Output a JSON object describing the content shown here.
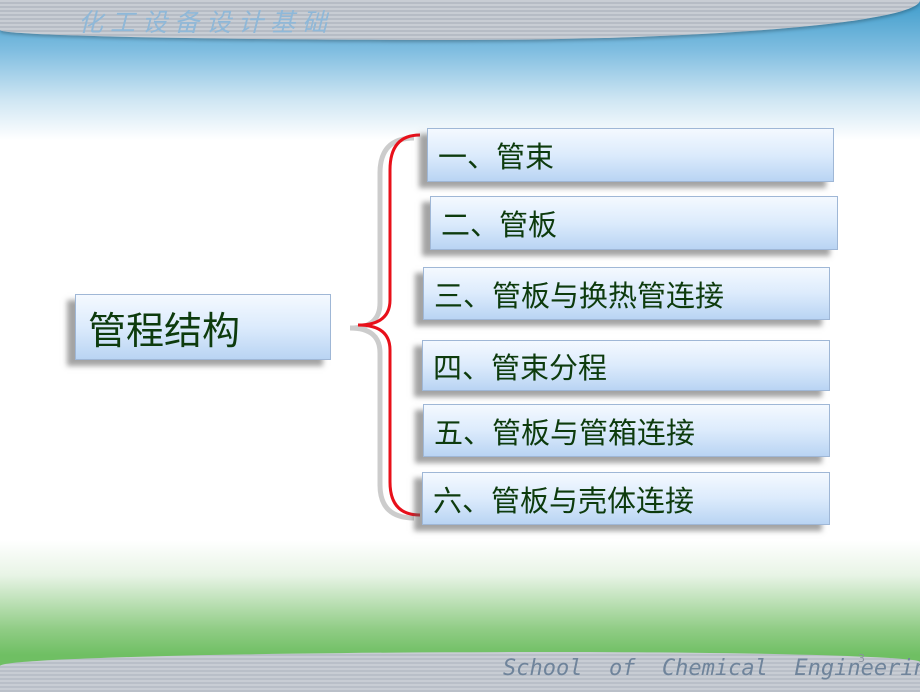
{
  "header": {
    "title": "化工设备设计基础"
  },
  "footer": {
    "school": "School  of  Chemical  Engineering",
    "page_number": "3"
  },
  "main_topic": "管程结构",
  "items": [
    "一、管束",
    "二、管板",
    "三、管板与换热管连接",
    "四、管束分程",
    "五、管板与管箱连接",
    "六、管板与壳体连接"
  ],
  "colors": {
    "brace": "#e8101a",
    "text": "#0d3b0d",
    "box": "#cfe2f8"
  }
}
